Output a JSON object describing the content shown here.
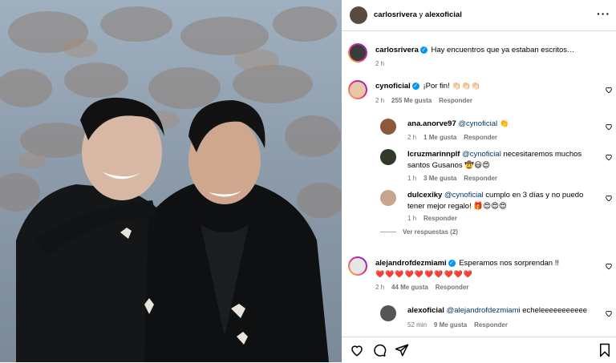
{
  "header": {
    "title_user1": "carlosrivera",
    "title_joiner": " y ",
    "title_user2": "alexoficial"
  },
  "caption": {
    "user": "carlosrivera",
    "text": "Hay encuentros que ya estaban escritos…",
    "time": "2 h"
  },
  "comments": [
    {
      "user": "cynoficial",
      "text": "¡Por fin! 👏🏻👏🏻👏🏻",
      "time": "2 h",
      "likes": "255 Me gusta",
      "reply": "Responder"
    },
    {
      "user": "ana.anorve97",
      "mention": "@cynoficial",
      "text": " 👏",
      "time": "2 h",
      "likes": "1 Me gusta",
      "reply": "Responder"
    },
    {
      "user": "lcruzmarinnplf",
      "mention": "@cynoficial",
      "text": " necesitaremos muchos santos Gusanos 🤠😃😍",
      "time": "1 h",
      "likes": "3 Me gusta",
      "reply": "Responder"
    },
    {
      "user": "dulcexiky",
      "mention": "@cynoficial",
      "text": " cumplo en 3 días y no puedo tener mejor regalo! 🎁😍😍😍",
      "time": "1 h",
      "reply": "Responder"
    },
    {
      "user": "alejandrofdezmiami",
      "text": "Esperamos nos sorprendan !!",
      "hearts": "❤️❤️❤️❤️❤️❤️❤️❤️❤️❤️",
      "time": "2 h",
      "likes": "44 Me gusta",
      "reply": "Responder"
    },
    {
      "user": "alexoficial",
      "mention": "@alejandrofdezmiami",
      "text": " echeleeeeeeeeeee",
      "time": "52 min",
      "likes": "9 Me gusta",
      "reply": "Responder"
    }
  ],
  "view_replies": "Ver respuestas (2)",
  "colors": {
    "verified": "#0095f6",
    "meta": "#737373",
    "mention": "#00376b",
    "border": "#dbdbdb"
  }
}
